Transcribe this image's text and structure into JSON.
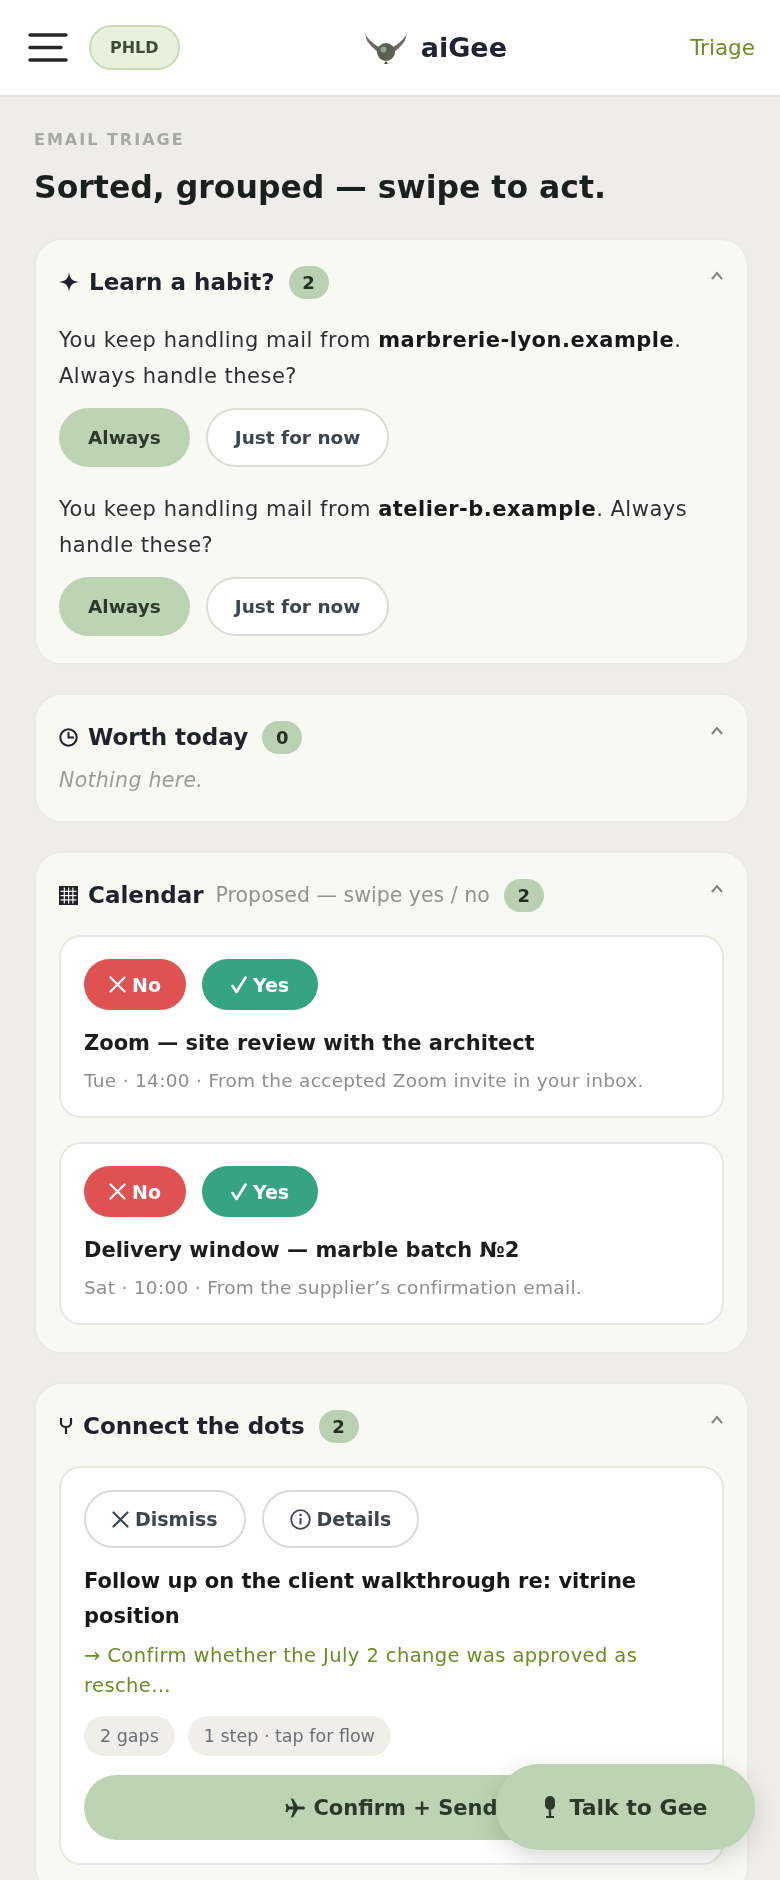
{
  "header": {
    "workspace_badge": "PHLD",
    "brand": "aiGee",
    "nav_link": "Triage"
  },
  "page": {
    "eyebrow": "EMAIL TRIAGE",
    "title": "Sorted, grouped — swipe to act."
  },
  "sections": [
    {
      "kind": "habits",
      "title": "Learn a habit?",
      "count": "2",
      "expanded": true,
      "suggestions": [
        {
          "text": "You keep handling mail from **marbrerie-lyon.example**. Always handle these?",
          "actions": [
            {
              "kind": "primary",
              "label": "Always"
            },
            {
              "kind": "secondary",
              "label": "Just for now"
            }
          ]
        },
        {
          "text": "You keep handling mail from **atelier-b.example**. Always handle these?",
          "actions": [
            {
              "kind": "primary",
              "label": "Always"
            },
            {
              "kind": "secondary",
              "label": "Just for now"
            }
          ]
        }
      ]
    },
    {
      "kind": "today",
      "title": "Worth today",
      "count": "0",
      "expanded": true,
      "empty_text": "Nothing here."
    },
    {
      "kind": "calendar",
      "title": "Calendar",
      "subtitle": "Proposed — swipe yes / no",
      "count": "2",
      "expanded": true,
      "events": [
        {
          "reject_label": "No",
          "accept_label": "Yes",
          "title": "Zoom — site review with the architect",
          "meta": "Tue · 14:00 · From the accepted Zoom invite in your inbox."
        },
        {
          "reject_label": "No",
          "accept_label": "Yes",
          "title": "Delivery window — marble batch №2",
          "meta": "Sat · 10:00 · From the supplier’s confirmation email."
        }
      ]
    },
    {
      "kind": "threads",
      "title": "Connect the dots",
      "count": "2",
      "expanded": true,
      "items": [
        {
          "dismiss_label": "Dismiss",
          "details_label": "Details",
          "title": "Follow up on the client walkthrough re: vitrine position",
          "next_step": "→ Confirm whether the July 2 change was approved as resche…",
          "tags": [
            "2 gaps",
            "1 step · tap for flow"
          ],
          "action_label": "Confirm + Send"
        }
      ]
    }
  ],
  "fab": {
    "label": "Talk to Gee"
  }
}
